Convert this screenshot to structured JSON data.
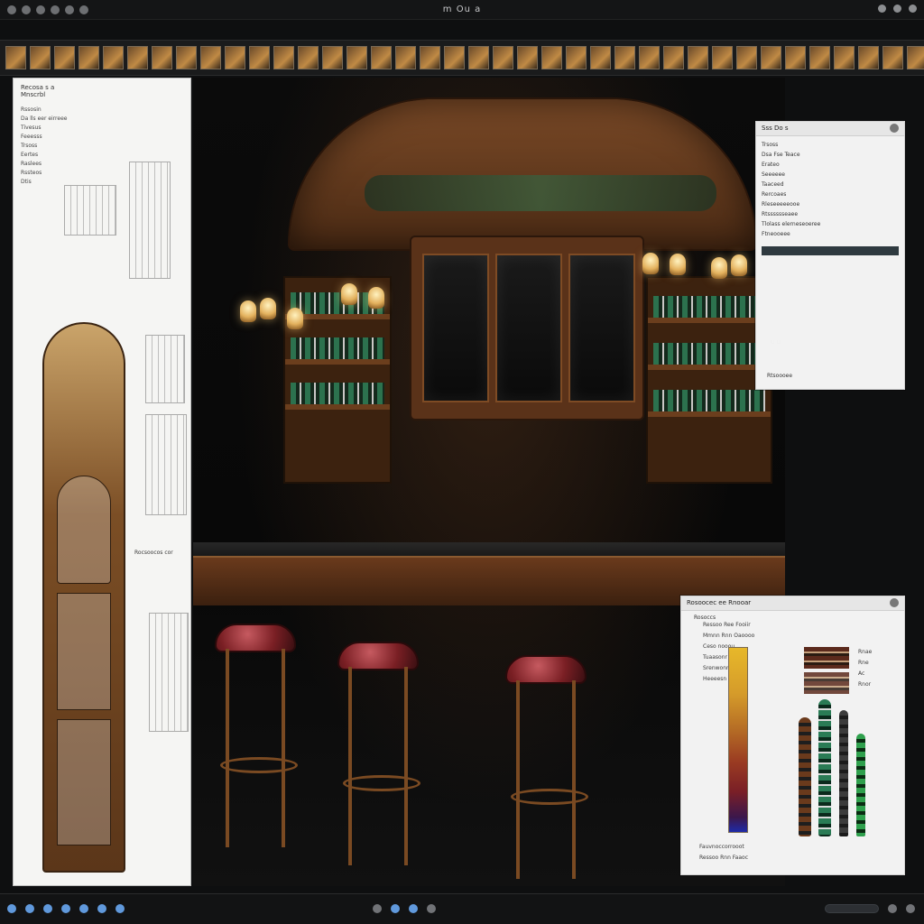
{
  "window": {
    "title": "m Ou a",
    "top_controls": [
      "control-1",
      "control-2",
      "control-3"
    ]
  },
  "filmstrip": {
    "thumb_count": 40
  },
  "left_panel": {
    "header_lines": [
      "Recosa s a",
      "Mnscrbl"
    ],
    "list_items": [
      "Rssosin",
      "Da lls eer eirreee",
      "Tivesus",
      "Feeesss",
      "Trsoss",
      "Eertes",
      "Raslees",
      "Rssteos",
      "Dtis"
    ],
    "caption": "Rocsoocos cor"
  },
  "floating_panel_top": {
    "title": "Sss Do s",
    "rows": [
      "Trsoss",
      "Dsa  Fse  Teace",
      "Erateo",
      "Seeeeee",
      "Taaceed",
      "Rercoaes",
      "Rleseeeeeooe",
      "Rtsssssseaee",
      "Tlolass elerneseoeree",
      "Ftneooeee"
    ],
    "slider_label": "u  u",
    "bottom_label": "Rtsoooee"
  },
  "floating_panel_bottom": {
    "title": "Rosoocec ee Rnooar",
    "subtitle": "Rosoccs",
    "row_labels": [
      "Ressoo  Ree Fooiir",
      "Mmnn  Rnn Oaoooo",
      "Ceso nooou",
      "Tuaasonr",
      "Srenwonr",
      "Heeeesn"
    ],
    "bottom_labels": [
      "Fauvnoccorrooot",
      "Ressoo  Rnn Faaoc"
    ],
    "side_labels": [
      "Rnae",
      "Rne",
      "Ac",
      "Rnor"
    ]
  },
  "bottom_bar": {
    "left_buttons": [
      "dock-1",
      "dock-2",
      "dock-3",
      "dock-4",
      "dock-5",
      "dock-6",
      "dock-7"
    ],
    "center_buttons": [
      "play-back",
      "play",
      "play-forward",
      "options"
    ],
    "right_buttons": [
      "zoom-fit",
      "zoom-100"
    ]
  },
  "colors": {
    "accent": "#6fb1ff",
    "wood_dark": "#3b200f",
    "wood_light": "#7b4a27",
    "leather_red": "#7a1f24",
    "bottle_green": "#2a7b55"
  }
}
